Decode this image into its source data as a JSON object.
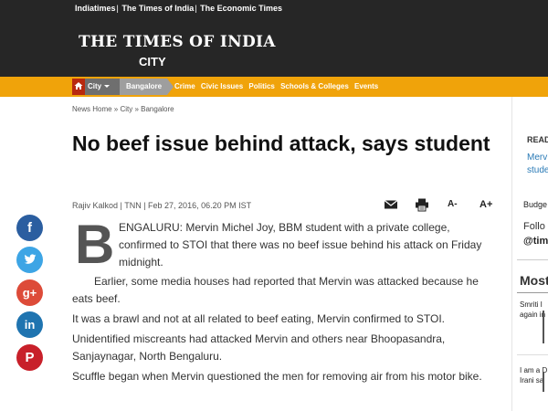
{
  "header": {
    "network_links": [
      "Indiatimes",
      "The Times of India",
      "The Economic Times"
    ],
    "masthead": "THE TIMES OF INDIA",
    "section": "CITY"
  },
  "nav": {
    "home_icon": "home-icon",
    "city": "City",
    "bangalore": "Bangalore",
    "items": [
      "Crime",
      "Civic Issues",
      "Politics",
      "Schools & Colleges",
      "Events"
    ]
  },
  "breadcrumb": "News Home » City » Bangalore",
  "article": {
    "title": "No beef issue behind attack, says student",
    "byline": "Rajiv Kalkod | TNN | Feb 27, 2016, 06.20 PM IST",
    "dropcap": "B",
    "p1_line1": "ENGALURU: Mervin Michel Joy, BBM student with a private college,",
    "p1_line2": "confirmed to STOI that there was no beef issue behind his attack on Friday",
    "p1_line3": "midnight.",
    "p2": "Earlier, some media houses had reported that Mervin was attacked because he eats beef.",
    "p3": "It was a brawl and not at all related to beef eating, Mervin confirmed to STOI.",
    "p4": "Unidentified miscreants had attacked Mervin and others near Bhoopasandra, Sanjaynagar, North Bengaluru.",
    "p5": "Scuffle began when Mervin questioned the men for removing air from his motor bike."
  },
  "tools": {
    "a_minus": "A-",
    "a_plus": "A+"
  },
  "social": {
    "facebook": "f",
    "google_plus": "g+",
    "linkedin": "in",
    "pinterest": "P"
  },
  "rail": {
    "read": "READ",
    "link_line1": "Merv",
    "link_line2": "stude",
    "budget": "Budge",
    "follow": "Follo",
    "handle": "@tim",
    "most": "Most",
    "story1_line1": "Smriti I",
    "story1_line2": "again in",
    "story2_line1": "I am a D",
    "story2_line2": "Irani sa"
  },
  "colors": {
    "header_bg": "#262626",
    "nav_bg": "#f0a30a",
    "home_bg": "#b8290e",
    "facebook": "#2b5ea0",
    "twitter": "#3da5e5",
    "google_plus": "#dd4b39",
    "linkedin": "#1f74b0",
    "pinterest": "#c8202a",
    "link": "#2a7ab6"
  }
}
